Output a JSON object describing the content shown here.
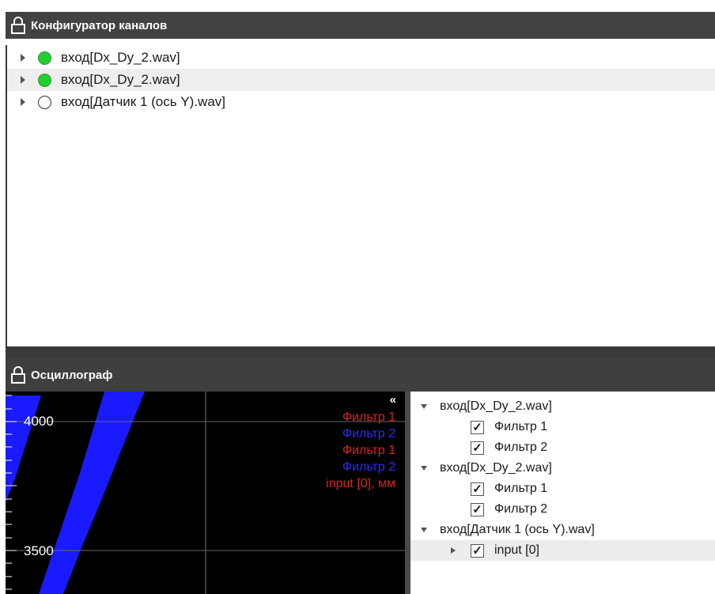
{
  "colors": {
    "header_bg": "#424242",
    "active_dot": "#1ed12c",
    "plot_bg": "#000000",
    "trace_blue": "#1a1aff",
    "legend_red": "#e02020",
    "legend_blue": "#2a2aff"
  },
  "channels_panel": {
    "title": "Конфигуратор каналов",
    "icon": "lock-icon",
    "items": [
      {
        "label": "вход[Dx_Dy_2.wav]",
        "status": "active"
      },
      {
        "label": "вход[Dx_Dy_2.wav]",
        "status": "active",
        "selected": true
      },
      {
        "label": "вход[Датчик 1 (ось Y).wav]",
        "status": "inactive"
      }
    ]
  },
  "oscillograph_panel": {
    "title": "Осциллограф",
    "icon": "lock-icon",
    "y_labels": [
      "4000",
      "3500"
    ],
    "collapse_icon": "double-chevron-left-icon",
    "legend": [
      {
        "text": "Фильтр 1",
        "color": "red"
      },
      {
        "text": "Фильтр 2",
        "color": "blue"
      },
      {
        "text": "Фильтр 1",
        "color": "red"
      },
      {
        "text": "Фильтр 2",
        "color": "blue"
      },
      {
        "text": "input [0], мм",
        "color": "red"
      }
    ],
    "tree": {
      "groups": [
        {
          "label": "вход[Dx_Dy_2.wav]",
          "items": [
            {
              "label": "Фильтр 1",
              "checked": true
            },
            {
              "label": "Фильтр 2",
              "checked": true
            }
          ]
        },
        {
          "label": "вход[Dx_Dy_2.wav]",
          "items": [
            {
              "label": "Фильтр 1",
              "checked": true
            },
            {
              "label": "Фильтр 2",
              "checked": true
            }
          ]
        },
        {
          "label": "вход[Датчик 1 (ось Y).wav]",
          "items": [
            {
              "label": "input [0]",
              "checked": true
            }
          ]
        }
      ]
    }
  }
}
